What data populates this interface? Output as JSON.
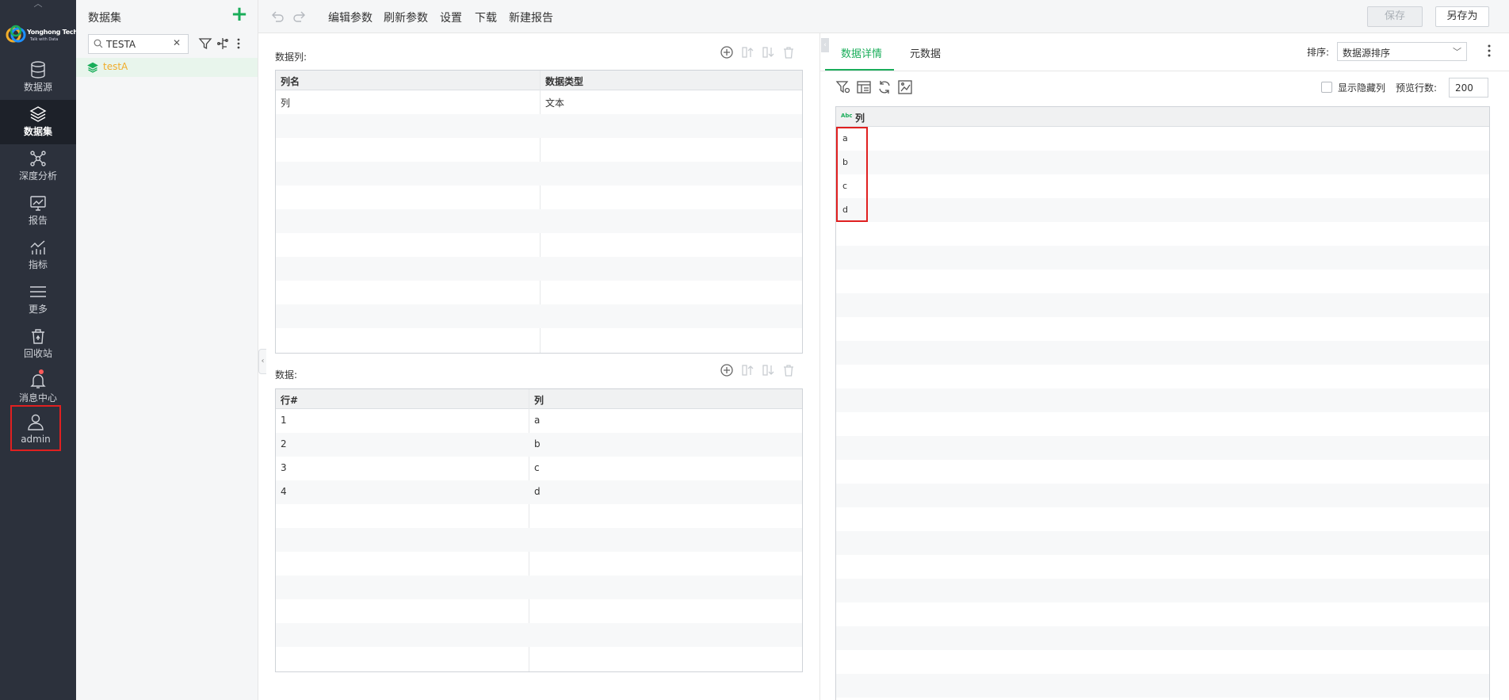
{
  "brand": {
    "name": "Yonghong Tech",
    "tagline": "Talk with Data"
  },
  "nav": {
    "items": [
      {
        "label": "数据源",
        "icon": "database-icon"
      },
      {
        "label": "数据集",
        "icon": "layers-icon",
        "active": true
      },
      {
        "label": "深度分析",
        "icon": "network-icon"
      },
      {
        "label": "报告",
        "icon": "report-chart-icon"
      },
      {
        "label": "指标",
        "icon": "metrics-icon"
      },
      {
        "label": "更多",
        "icon": "menu-icon"
      },
      {
        "label": "回收站",
        "icon": "recycle-bin-icon"
      },
      {
        "label": "消息中心",
        "icon": "bell-icon",
        "badge": true
      }
    ],
    "user": {
      "label": "admin",
      "icon": "user-icon"
    }
  },
  "datasets": {
    "title": "数据集",
    "search_value": "TESTA",
    "items": [
      {
        "label": "testA"
      }
    ]
  },
  "toolbar": {
    "menus": [
      "编辑参数",
      "刷新参数",
      "设置",
      "下载",
      "新建报告"
    ],
    "save_label": "保存",
    "save_as_label": "另存为"
  },
  "columns_section": {
    "label": "数据列:",
    "headers": [
      "列名",
      "数据类型"
    ],
    "rows": [
      [
        "列",
        "文本"
      ]
    ]
  },
  "data_section": {
    "label": "数据:",
    "headers": [
      "行#",
      "列"
    ],
    "rows": [
      [
        "1",
        "a"
      ],
      [
        "2",
        "b"
      ],
      [
        "3",
        "c"
      ],
      [
        "4",
        "d"
      ]
    ]
  },
  "detail": {
    "tabs": [
      "数据详情",
      "元数据"
    ],
    "sort_label": "排序:",
    "sort_value": "数据源排序",
    "show_hidden_label": "显示隐藏列",
    "preview_rows_label": "预览行数:",
    "preview_rows_value": "200",
    "column_type_badge": "Abc",
    "column_header": "列",
    "values": [
      "a",
      "b",
      "c",
      "d"
    ]
  },
  "colors": {
    "accent": "#1aad5a",
    "highlight": "#e02020",
    "nav_bg": "#2c313c",
    "dataset_item": "#f0ac2a"
  }
}
